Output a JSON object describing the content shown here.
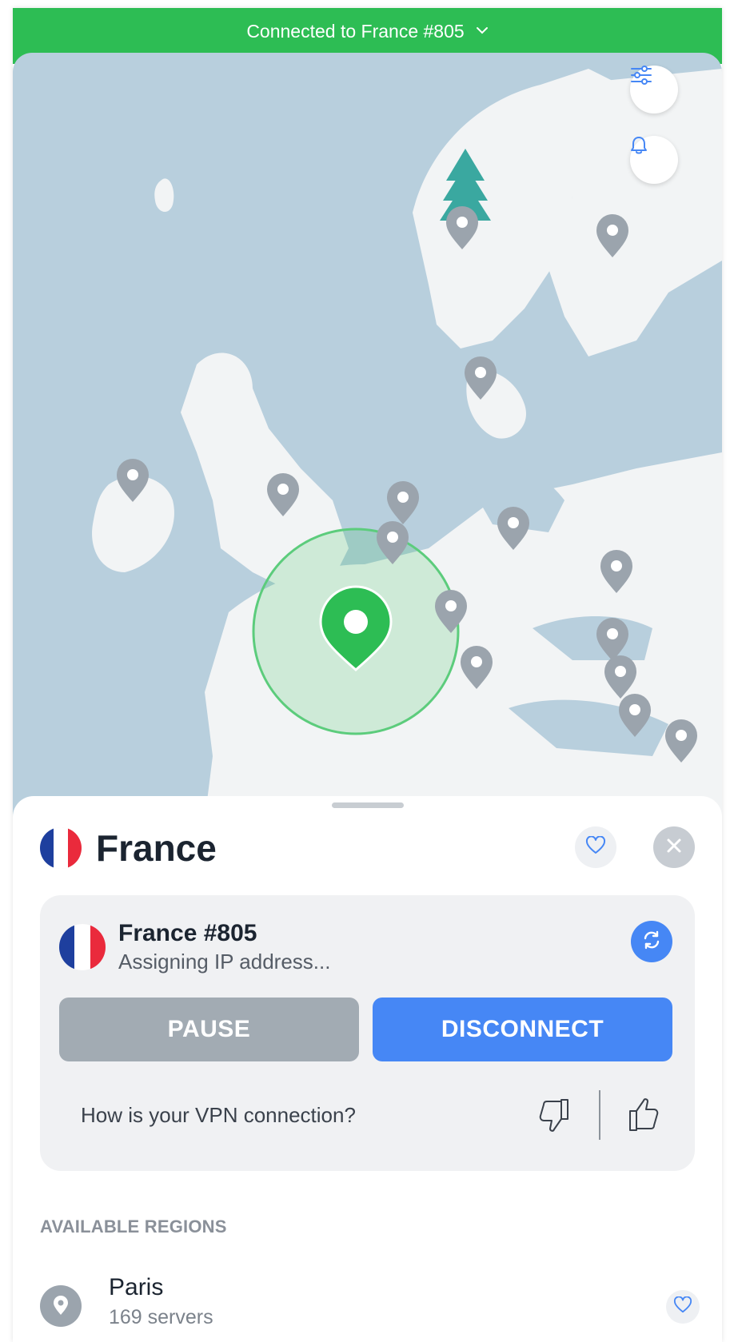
{
  "header": {
    "status_text": "Connected to France #805"
  },
  "colors": {
    "connected": "#2dbd54",
    "accent": "#4687f5",
    "pause_gray": "#a2abb3",
    "map_water": "#b8cfdd",
    "map_land": "#f2f4f5",
    "pin_gray": "#9ba4ad"
  },
  "map": {
    "controls": [
      "settings-sliders-icon",
      "notification-bell-icon"
    ],
    "active_pin": "France"
  },
  "panel": {
    "country": "France",
    "server": {
      "name": "France #805",
      "status": "Assigning IP address..."
    },
    "pause_label": "PAUSE",
    "disconnect_label": "DISCONNECT",
    "feedback_question": "How is your VPN connection?",
    "regions_title": "AVAILABLE REGIONS",
    "regions": [
      {
        "name": "Paris",
        "servers": "169 servers"
      }
    ]
  }
}
